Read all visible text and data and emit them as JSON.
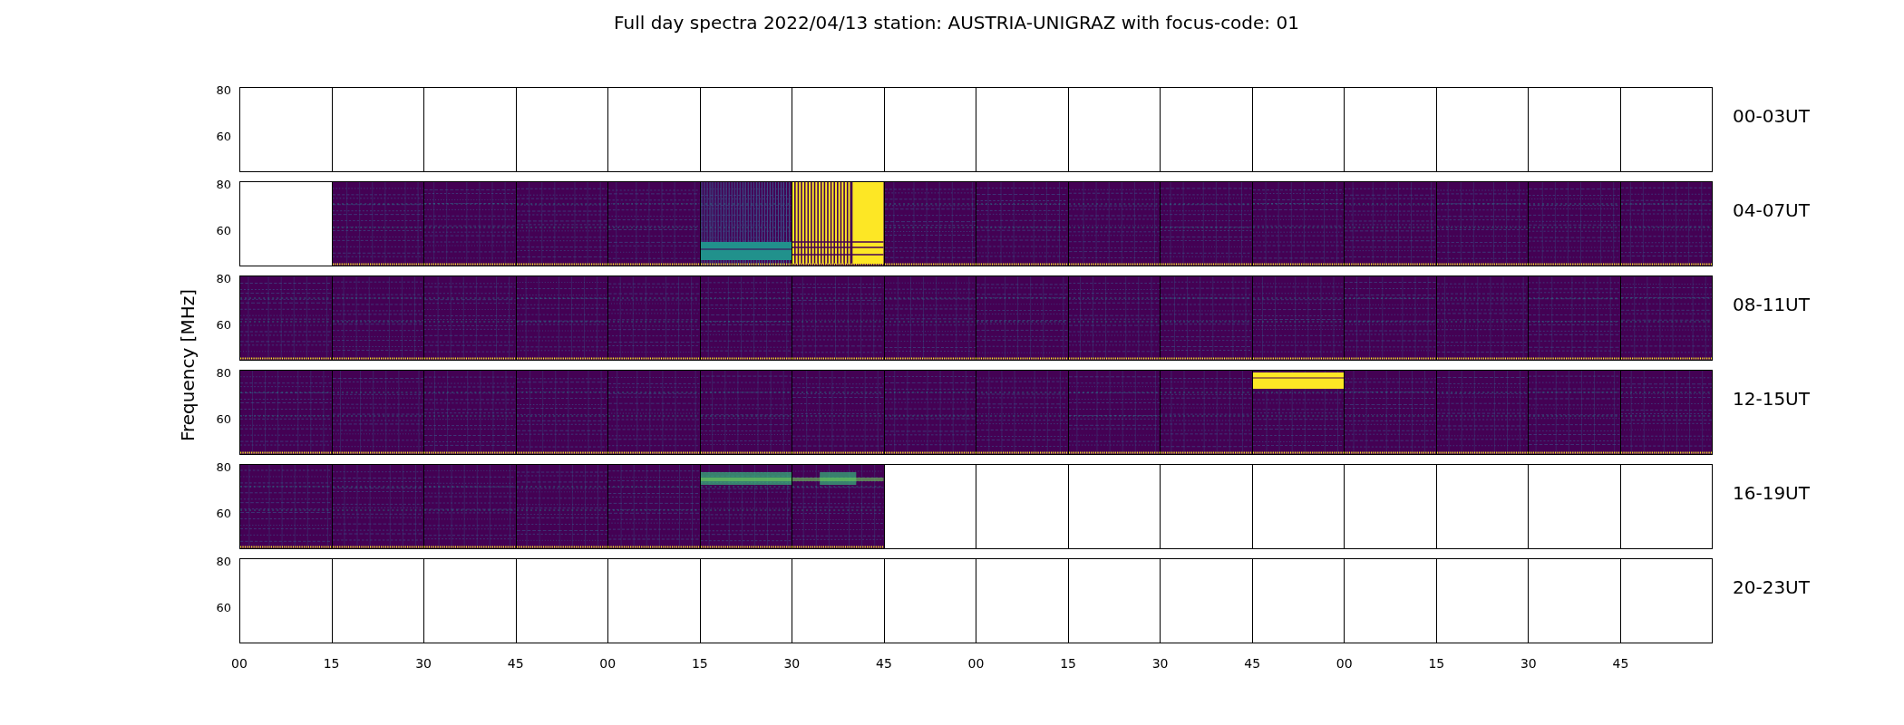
{
  "title": "Full day spectra 2022/04/13 station: AUSTRIA-UNIGRAZ with focus-code: 01",
  "ylabel": "Frequency [MHz]",
  "rows": [
    {
      "label": "00-03UT",
      "yticks": [
        "80",
        "60"
      ],
      "panels": [
        {
          "kind": "empty"
        },
        {
          "kind": "empty"
        },
        {
          "kind": "empty"
        },
        {
          "kind": "empty"
        },
        {
          "kind": "empty"
        },
        {
          "kind": "empty"
        },
        {
          "kind": "empty"
        },
        {
          "kind": "empty"
        },
        {
          "kind": "empty"
        },
        {
          "kind": "empty"
        },
        {
          "kind": "empty"
        },
        {
          "kind": "empty"
        },
        {
          "kind": "empty"
        },
        {
          "kind": "empty"
        },
        {
          "kind": "empty"
        },
        {
          "kind": "empty"
        }
      ]
    },
    {
      "label": "04-07UT",
      "yticks": [
        "80",
        "60"
      ],
      "panels": [
        {
          "kind": "empty"
        },
        {
          "kind": "spectrum"
        },
        {
          "kind": "spectrum"
        },
        {
          "kind": "spectrum"
        },
        {
          "kind": "spectrum"
        },
        {
          "kind": "interference"
        },
        {
          "kind": "saturated"
        },
        {
          "kind": "spectrum"
        },
        {
          "kind": "spectrum"
        },
        {
          "kind": "spectrum"
        },
        {
          "kind": "spectrum"
        },
        {
          "kind": "spectrum"
        },
        {
          "kind": "spectrum"
        },
        {
          "kind": "spectrum"
        },
        {
          "kind": "spectrum"
        },
        {
          "kind": "spectrum"
        }
      ]
    },
    {
      "label": "08-11UT",
      "yticks": [
        "80",
        "60"
      ],
      "panels": [
        {
          "kind": "spectrum"
        },
        {
          "kind": "spectrum"
        },
        {
          "kind": "spectrum"
        },
        {
          "kind": "spectrum"
        },
        {
          "kind": "spectrum"
        },
        {
          "kind": "spectrum"
        },
        {
          "kind": "spectrum"
        },
        {
          "kind": "spectrum"
        },
        {
          "kind": "spectrum"
        },
        {
          "kind": "spectrum"
        },
        {
          "kind": "spectrum"
        },
        {
          "kind": "spectrum"
        },
        {
          "kind": "spectrum"
        },
        {
          "kind": "spectrum"
        },
        {
          "kind": "spectrum"
        },
        {
          "kind": "spectrum"
        }
      ]
    },
    {
      "label": "12-15UT",
      "yticks": [
        "80",
        "60"
      ],
      "panels": [
        {
          "kind": "spectrum"
        },
        {
          "kind": "spectrum"
        },
        {
          "kind": "spectrum"
        },
        {
          "kind": "spectrum"
        },
        {
          "kind": "spectrum"
        },
        {
          "kind": "spectrum"
        },
        {
          "kind": "spectrum"
        },
        {
          "kind": "spectrum"
        },
        {
          "kind": "spectrum"
        },
        {
          "kind": "spectrum"
        },
        {
          "kind": "spectrum"
        },
        {
          "kind": "flare"
        },
        {
          "kind": "spectrum"
        },
        {
          "kind": "spectrum"
        },
        {
          "kind": "spectrum"
        },
        {
          "kind": "spectrum"
        }
      ]
    },
    {
      "label": "16-19UT",
      "yticks": [
        "80",
        "60"
      ],
      "panels": [
        {
          "kind": "spectrum"
        },
        {
          "kind": "spectrum"
        },
        {
          "kind": "spectrum"
        },
        {
          "kind": "spectrum"
        },
        {
          "kind": "spectrum"
        },
        {
          "kind": "burst"
        },
        {
          "kind": "burst"
        },
        {
          "kind": "empty"
        },
        {
          "kind": "empty"
        },
        {
          "kind": "empty"
        },
        {
          "kind": "empty"
        },
        {
          "kind": "empty"
        },
        {
          "kind": "empty"
        },
        {
          "kind": "empty"
        },
        {
          "kind": "empty"
        },
        {
          "kind": "empty"
        }
      ]
    },
    {
      "label": "20-23UT",
      "yticks": [
        "80",
        "60"
      ],
      "panels": [
        {
          "kind": "empty"
        },
        {
          "kind": "empty"
        },
        {
          "kind": "empty"
        },
        {
          "kind": "empty"
        },
        {
          "kind": "empty"
        },
        {
          "kind": "empty"
        },
        {
          "kind": "empty"
        },
        {
          "kind": "empty"
        },
        {
          "kind": "empty"
        },
        {
          "kind": "empty"
        },
        {
          "kind": "empty"
        },
        {
          "kind": "empty"
        },
        {
          "kind": "empty"
        },
        {
          "kind": "empty"
        },
        {
          "kind": "empty"
        },
        {
          "kind": "empty"
        }
      ]
    }
  ],
  "xticks": [
    "00",
    "15",
    "30",
    "45",
    "00",
    "15",
    "30",
    "45",
    "00",
    "15",
    "30",
    "45",
    "00",
    "15",
    "30",
    "45"
  ]
}
